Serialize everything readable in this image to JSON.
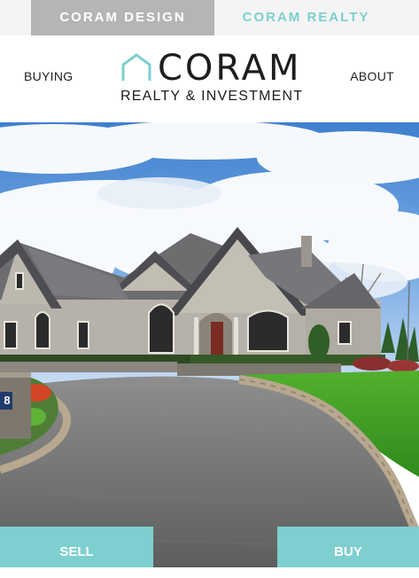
{
  "brand_tabs": {
    "design": "CORAM DESIGN",
    "realty": "CORAM REALTY"
  },
  "nav": {
    "left": "BUYING",
    "right": "ABOUT"
  },
  "logo": {
    "word": "CORAM",
    "subtitle": "REALTY & INVESTMENT",
    "icon": "house-outline-icon"
  },
  "hero": {
    "image": "stone-house-with-driveway"
  },
  "cta": {
    "sell": "SELL",
    "buy": "BUY"
  },
  "house_number": "8",
  "colors": {
    "accent": "#7ecfcf",
    "design_tab_bg": "#b5b5b5",
    "realty_tab_text": "#7ecfcf",
    "text_dark": "#1d1d1d"
  }
}
